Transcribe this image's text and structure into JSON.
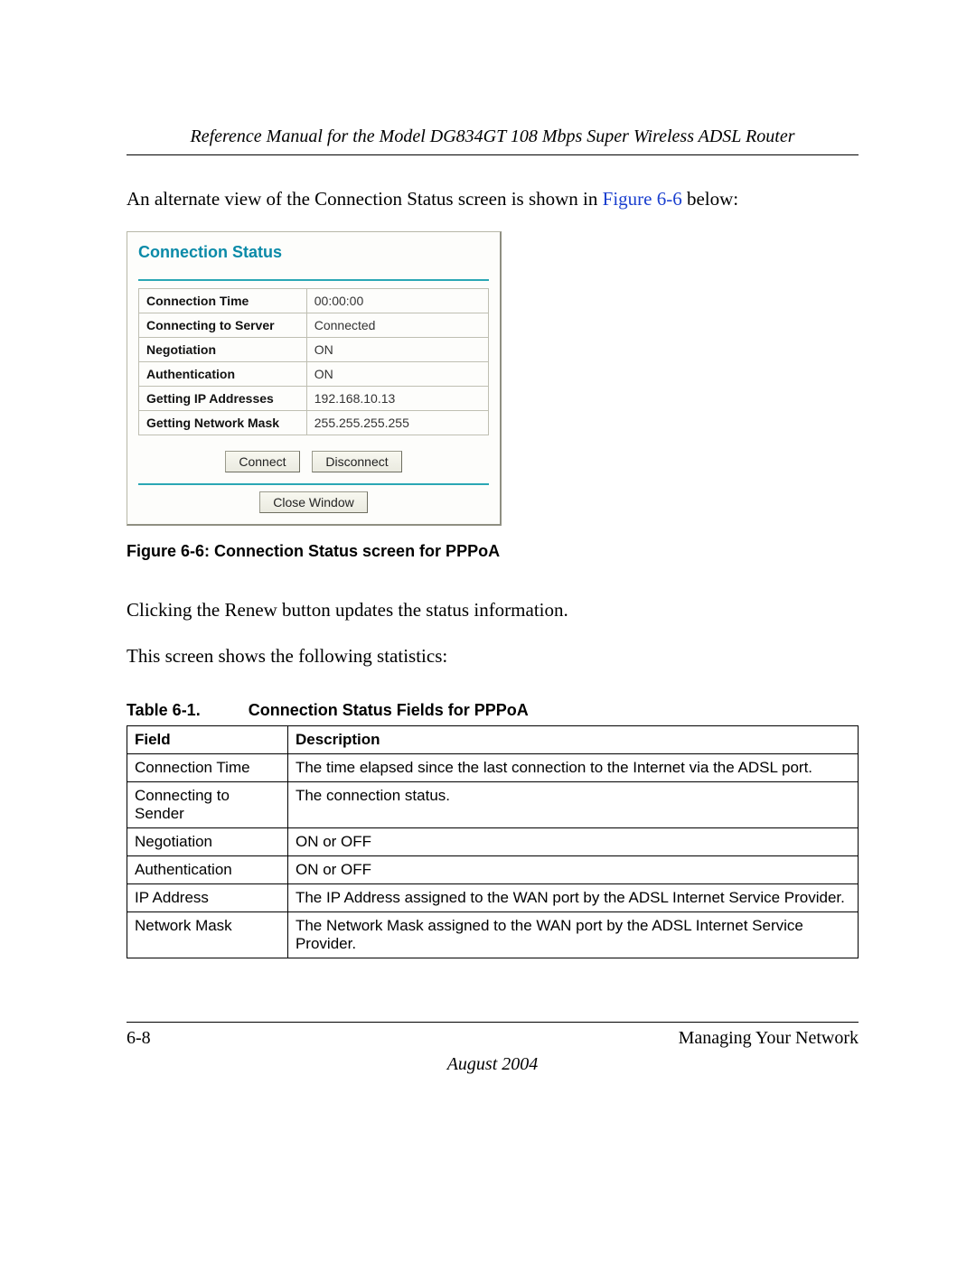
{
  "header": {
    "title": "Reference Manual for the Model DG834GT 108 Mbps Super Wireless ADSL Router"
  },
  "intro": {
    "text_before_link": "An alternate view of the Connection Status screen is shown in ",
    "figure_link": "Figure 6-6",
    "text_after_link": " below:"
  },
  "screenshot": {
    "title": "Connection Status",
    "rows": [
      {
        "label": "Connection Time",
        "value": "00:00:00"
      },
      {
        "label": "Connecting to Server",
        "value": "Connected"
      },
      {
        "label": "Negotiation",
        "value": "ON"
      },
      {
        "label": "Authentication",
        "value": "ON"
      },
      {
        "label": "Getting IP Addresses",
        "value": "192.168.10.13"
      },
      {
        "label": "Getting Network Mask",
        "value": "255.255.255.255"
      }
    ],
    "buttons": {
      "connect": "Connect",
      "disconnect": "Disconnect",
      "close_window": "Close Window"
    }
  },
  "figure_caption": "Figure 6-6:  Connection Status screen for PPPoA",
  "body": {
    "para1": "Clicking the Renew button updates the status information.",
    "para2": "This screen shows the following statistics:"
  },
  "table_caption": {
    "num": "Table 6-1.",
    "title": "Connection Status Fields for PPPoA"
  },
  "fields_table": {
    "headers": {
      "field": "Field",
      "description": "Description"
    },
    "rows": [
      {
        "field": "Connection Time",
        "desc": "The time elapsed since the last connection to the Internet via the ADSL port."
      },
      {
        "field": "Connecting to Sender",
        "desc": "The connection status."
      },
      {
        "field": "Negotiation",
        "desc": "ON or OFF"
      },
      {
        "field": "Authentication",
        "desc": "ON or OFF"
      },
      {
        "field": "IP Address",
        "desc": "The IP Address assigned to the WAN port by the ADSL Internet Service Provider."
      },
      {
        "field": "Network Mask",
        "desc": "The Network Mask assigned to the WAN port by the ADSL Internet Service Provider."
      }
    ]
  },
  "footer": {
    "page": "6-8",
    "section": "Managing Your Network",
    "date": "August 2004"
  }
}
